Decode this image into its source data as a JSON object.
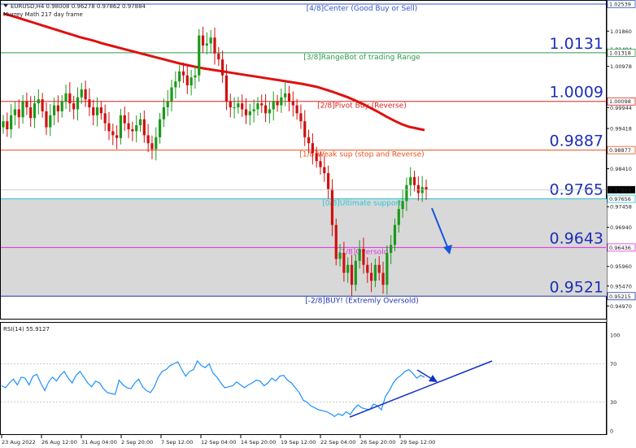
{
  "header": {
    "symbol_line": "EURUSD,H4  0.98008 0.96278 0.97862 0.97884",
    "indicator_name": "Murrey Math 217 day frame"
  },
  "rsi_header": "RSI(14) 55.9127",
  "colors": {
    "up": "#1a9a1a",
    "down": "#d01010",
    "ma": "#e01010",
    "rsi": "#1e90ff",
    "arrow": "#1656d8",
    "zone": "#d8d8d8"
  },
  "murrey_levels": [
    {
      "label": "[4/8]Center (Good Buy or Sell)",
      "price": 1.02539,
      "tag": "1.02539",
      "big": "",
      "color": "#3355cc"
    },
    {
      "label": "[3/8]RangeBot of trading Range",
      "price": 1.01318,
      "tag": "1.01318",
      "big": "1.0131",
      "color": "#2e9a4e"
    },
    {
      "label": "[2/8]Pivot Buy (Reverse)",
      "price": 1.00098,
      "tag": "1.00098",
      "big": "1.0009",
      "color": "#e02020"
    },
    {
      "label": "[1/8]Weak sup (stop and Reverse)",
      "price": 0.98877,
      "tag": "0.98877",
      "big": "0.9887",
      "color": "#e8501a"
    },
    {
      "label": "[0/8]Ultimate support",
      "price": 0.97656,
      "tag": "0.97656",
      "big": "0.9765",
      "color": "#26c6d6"
    },
    {
      "label": "[-1/8]Oversold",
      "price": 0.96436,
      "tag": "0.96436",
      "big": "0.9643",
      "color": "#e030e0"
    },
    {
      "label": "[-2/8]BUY! (Extremly Oversold)",
      "price": 0.95215,
      "tag": "0.95215",
      "big": "0.9521",
      "color": "#2233aa"
    }
  ],
  "price_axis": {
    "ticks": [
      "1.01860",
      "1.01404",
      "1.00978",
      "0.99944",
      "0.99418",
      "0.98410",
      "0.97458",
      "0.96940",
      "0.95960",
      "0.95470",
      "0.94970"
    ],
    "ylim": [
      0.9465,
      1.026
    ]
  },
  "current_price": "0.97884",
  "rsi_axis": {
    "ticks": [
      "100",
      "70",
      "30",
      "0"
    ],
    "ylim": [
      0,
      100
    ]
  },
  "x_axis": {
    "labels": [
      "23 Aug 2022",
      "26 Aug 12:00",
      "31 Aug 04:00",
      "2 Sep 20:00",
      "7 Sep 12:00",
      "12 Sep 04:00",
      "14 Sep 20:00",
      "19 Sep 12:00",
      "22 Sep 04:00",
      "26 Sep 20:00",
      "29 Sep 12:00"
    ]
  },
  "chart_data": {
    "type": "candlestick",
    "rsi_levels": [
      70,
      30
    ],
    "ma_217": [
      1.023,
      1.0225,
      1.0219,
      1.0213,
      1.0207,
      1.0201,
      1.0195,
      1.0189,
      1.0183,
      1.0177,
      1.0171,
      1.0166,
      1.0161,
      1.0155,
      1.015,
      1.0145,
      1.014,
      1.0135,
      1.013,
      1.0125,
      1.012,
      1.0115,
      1.011,
      1.0105,
      1.0101,
      1.0097,
      1.0093,
      1.009,
      1.0087,
      1.0084,
      1.0081,
      1.0078,
      1.0075,
      1.0072,
      1.0069,
      1.0066,
      1.0063,
      1.006,
      1.0057,
      1.0054,
      1.005,
      1.0046,
      1.004,
      1.0034,
      1.0027,
      1.002,
      1.0012,
      1.0003,
      0.9993,
      0.9983,
      0.9972,
      0.9962,
      0.9953,
      0.9946,
      0.9942,
      0.9938
    ],
    "close": [
      0.996,
      0.994,
      0.9975,
      0.999,
      0.997,
      1.001,
      0.9995,
      0.9968,
      1.0005,
      1.0015,
      0.9985,
      0.9945,
      0.9975,
      1.0,
      0.9985,
      1.001,
      1.003,
      1.0005,
      0.999,
      1.002,
      1.004,
      1.0015,
      0.9995,
      0.9975,
      0.9995,
      0.998,
      0.9955,
      0.9935,
      0.9925,
      0.9918,
      0.9975,
      0.9955,
      0.994,
      0.9935,
      0.995,
      0.9965,
      0.9925,
      0.9905,
      0.989,
      0.992,
      0.9965,
      0.9995,
      1.001,
      1.0045,
      1.006,
      1.0085,
      1.0075,
      1.005,
      1.007,
      1.0075,
      1.0175,
      1.015,
      1.0155,
      1.017,
      1.013,
      1.0115,
      1.0075,
      1.001,
      0.9995,
      0.9995,
      1.0005,
      0.999,
      0.9975,
      0.9985,
      0.999,
      1.0005,
      1.0,
      0.998,
      0.999,
      1.001,
      1.0,
      1.002,
      1.003,
      1.001,
      1.0,
      0.998,
      0.996,
      0.992,
      0.9905,
      0.988,
      0.986,
      0.9845,
      0.983,
      0.979,
      0.97,
      0.9615,
      0.963,
      0.958,
      0.96,
      0.955,
      0.961,
      0.964,
      0.96,
      0.958,
      0.956,
      0.96,
      0.958,
      0.955,
      0.963,
      0.965,
      0.97,
      0.974,
      0.976,
      0.98,
      0.982,
      0.98,
      0.978,
      0.9795,
      0.9788
    ],
    "rsi": [
      47,
      45,
      50,
      54,
      48,
      56,
      55,
      48,
      57,
      59,
      50,
      42,
      51,
      56,
      52,
      58,
      62,
      55,
      50,
      58,
      62,
      56,
      50,
      46,
      52,
      50,
      44,
      40,
      39,
      38,
      53,
      48,
      45,
      44,
      50,
      54,
      46,
      42,
      40,
      46,
      56,
      62,
      64,
      68,
      70,
      72,
      64,
      57,
      62,
      64,
      73,
      68,
      66,
      70,
      60,
      56,
      50,
      45,
      46,
      47,
      51,
      48,
      45,
      48,
      50,
      53,
      52,
      47,
      50,
      55,
      52,
      57,
      58,
      53,
      50,
      45,
      40,
      32,
      30,
      26,
      24,
      22,
      21,
      20,
      18,
      15,
      18,
      16,
      20,
      17,
      23,
      27,
      24,
      23,
      22,
      28,
      26,
      22,
      36,
      42,
      50,
      55,
      58,
      62,
      64,
      60,
      55,
      58,
      56
    ]
  }
}
